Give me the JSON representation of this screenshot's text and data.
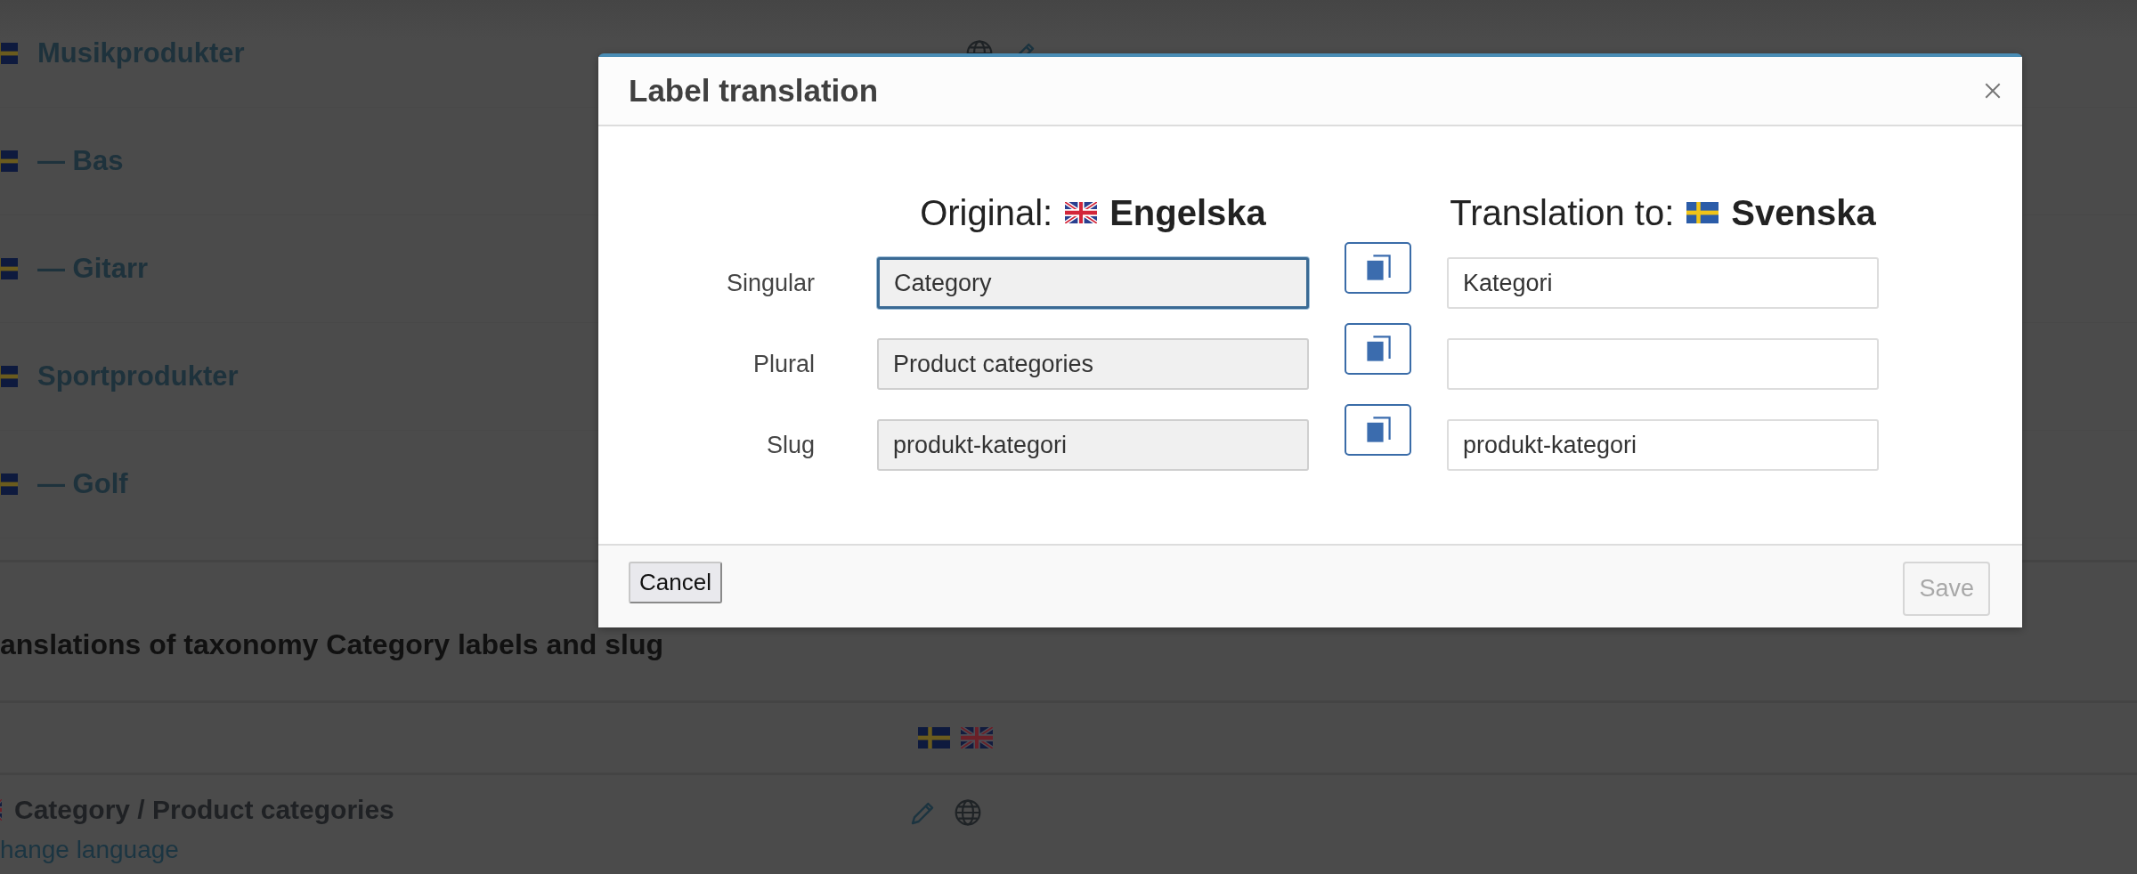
{
  "background_page": {
    "terms": [
      {
        "name": "Musikprodukter"
      },
      {
        "name": "— Bas"
      },
      {
        "name": "— Gitarr"
      },
      {
        "name": "Sportprodukter"
      },
      {
        "name": "— Golf"
      }
    ],
    "section_title": "anslations of taxonomy Category labels and slug",
    "label_row": {
      "name": "Category / Product categories",
      "link": "hange language"
    }
  },
  "dialog": {
    "title": "Label translation",
    "original_heading": {
      "label": "Original:",
      "language": "Engelska"
    },
    "translation_heading": {
      "label": "Translation to:",
      "language": "Svenska"
    },
    "fields": [
      {
        "label": "Singular",
        "original": "Category",
        "translation": "Kategori",
        "focused": true
      },
      {
        "label": "Plural",
        "original": "Product categories",
        "focused": false
      },
      {
        "label": "Slug",
        "original": "produkt-kategori",
        "translation": "produkt-kategori",
        "focused": false
      }
    ],
    "cancel": "Cancel",
    "save": "Save",
    "save_disabled": true
  }
}
